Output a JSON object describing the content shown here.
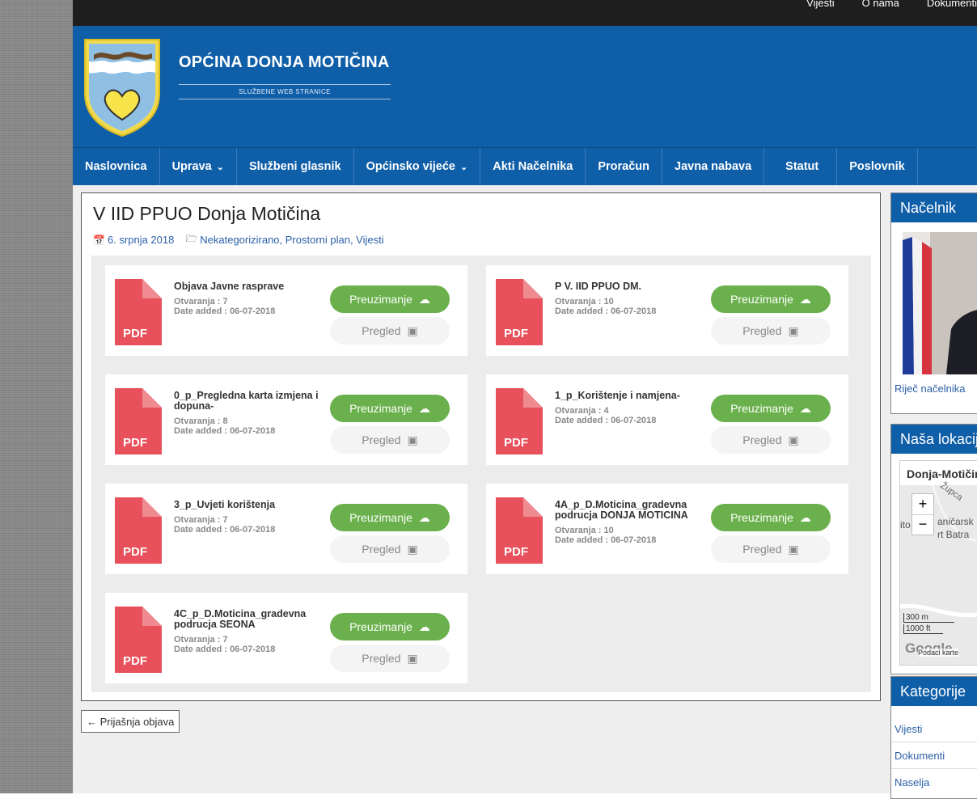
{
  "topbar": {
    "links": [
      "Vijesti",
      "O nama",
      "Dokumenti"
    ]
  },
  "header": {
    "title": "OPĆINA DONJA MOTIČINA",
    "subtitle": "SLUŽBENE WEB STRANICE"
  },
  "nav": {
    "items": [
      {
        "label": "Naslovnica",
        "dropdown": false
      },
      {
        "label": "Uprava",
        "dropdown": true
      },
      {
        "label": "Službeni glasnik",
        "dropdown": false
      },
      {
        "label": "Općinsko vijeće",
        "dropdown": true
      },
      {
        "label": "Akti Načelnika",
        "dropdown": false
      },
      {
        "label": "Proračun",
        "dropdown": false
      },
      {
        "label": "Javna nabava",
        "dropdown": false
      },
      {
        "label": "Statut",
        "dropdown": false
      },
      {
        "label": "Poslovnik",
        "dropdown": false
      }
    ]
  },
  "post": {
    "title": "V IID PPUO Donja Motičina",
    "date": "6. srpnja 2018",
    "categories": "Nekategorizirano, Prostorni plan, Vijesti"
  },
  "documents": [
    {
      "title": "Objava Javne rasprave",
      "opens": "Otvaranja : 7",
      "date_added": "Date added : 06-07-2018"
    },
    {
      "title": "P V. IID PPUO DM.",
      "opens": "Otvaranja : 10",
      "date_added": "Date added : 06-07-2018"
    },
    {
      "title": "0_p_Pregledna karta izmjena i dopuna-",
      "opens": "Otvaranja : 8",
      "date_added": "Date added : 06-07-2018"
    },
    {
      "title": "1_p_Korištenje i namjena-",
      "opens": "Otvaranja : 4",
      "date_added": "Date added : 06-07-2018"
    },
    {
      "title": "3_p_Uvjeti korištenja",
      "opens": "Otvaranja : 7",
      "date_added": "Date added : 06-07-2018"
    },
    {
      "title": "4A_p_D.Moticina_gradevna podrucja DONJA MOTICINA",
      "opens": "Otvaranja : 10",
      "date_added": "Date added : 06-07-2018"
    },
    {
      "title": "4C_p_D.Moticina_gradevna podrucja SEONA",
      "opens": "Otvaranja : 7",
      "date_added": "Date added : 06-07-2018"
    }
  ],
  "labels": {
    "download": "Preuzimanje",
    "preview": "Pregled",
    "pdf": "PDF",
    "prev_post": "← Prijašnja objava"
  },
  "sidebar": {
    "nacelnik": {
      "title": "Načelnik",
      "link": "Riječ načelnika"
    },
    "location": {
      "title": "Naša lokacija",
      "map_title": "Donja-Motičina",
      "zoom_in": "+",
      "zoom_out": "−",
      "scale_m": "300 m",
      "scale_ft": "1000 ft",
      "google": "Google",
      "map_data": "Podaci karte",
      "map_labels": [
        "Župca",
        "ito",
        "aničarsk",
        "rt Batra"
      ]
    },
    "categories": {
      "title": "Kategorije",
      "items": [
        "Vijesti",
        "Dokumenti",
        "Naselja"
      ]
    }
  },
  "colors": {
    "brand_blue": "#0f5ea8",
    "download_green": "#6ab04c",
    "pdf_red": "#e8505b"
  }
}
